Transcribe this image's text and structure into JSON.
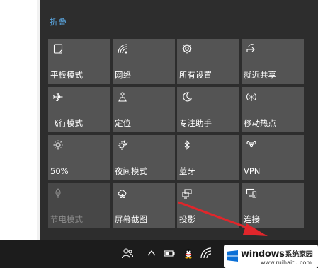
{
  "action_center": {
    "collapse_label": "折叠",
    "tiles": [
      {
        "label": "平板模式",
        "icon": "tablet-mode-icon",
        "state": "off"
      },
      {
        "label": "网络",
        "icon": "network-icon",
        "state": "off"
      },
      {
        "label": "所有设置",
        "icon": "gear-icon",
        "state": "off"
      },
      {
        "label": "就近共享",
        "icon": "nearby-share-icon",
        "state": "off"
      },
      {
        "label": "飞行模式",
        "icon": "airplane-icon",
        "state": "off"
      },
      {
        "label": "定位",
        "icon": "location-icon",
        "state": "off"
      },
      {
        "label": "专注助手",
        "icon": "moon-icon",
        "state": "off"
      },
      {
        "label": "移动热点",
        "icon": "hotspot-icon",
        "state": "off"
      },
      {
        "label": "50%",
        "icon": "brightness-icon",
        "state": "off"
      },
      {
        "label": "夜间模式",
        "icon": "night-light-icon",
        "state": "off"
      },
      {
        "label": "蓝牙",
        "icon": "bluetooth-icon",
        "state": "off"
      },
      {
        "label": "VPN",
        "icon": "vpn-icon",
        "state": "off"
      },
      {
        "label": "节电模式",
        "icon": "battery-saver-icon",
        "state": "disabled"
      },
      {
        "label": "屏幕截图",
        "icon": "screen-snip-icon",
        "state": "off"
      },
      {
        "label": "投影",
        "icon": "project-icon",
        "state": "off"
      },
      {
        "label": "连接",
        "icon": "connect-icon",
        "state": "off"
      }
    ]
  },
  "taskbar": {
    "icons": [
      "people-icon",
      "chevron-up-icon",
      "battery-icon",
      "qq-icon",
      "wifi-icon"
    ]
  },
  "watermark": {
    "brand": "windows",
    "brand_cn": "系统家园",
    "url": "www.ruihaitu.com"
  },
  "colors": {
    "panel_bg": "#2d2d2d",
    "tile_bg": "#545454",
    "accent_link": "#5aa6e0",
    "taskbar_bg": "#1c1c1c",
    "annotation_arrow": "#e0262b"
  }
}
